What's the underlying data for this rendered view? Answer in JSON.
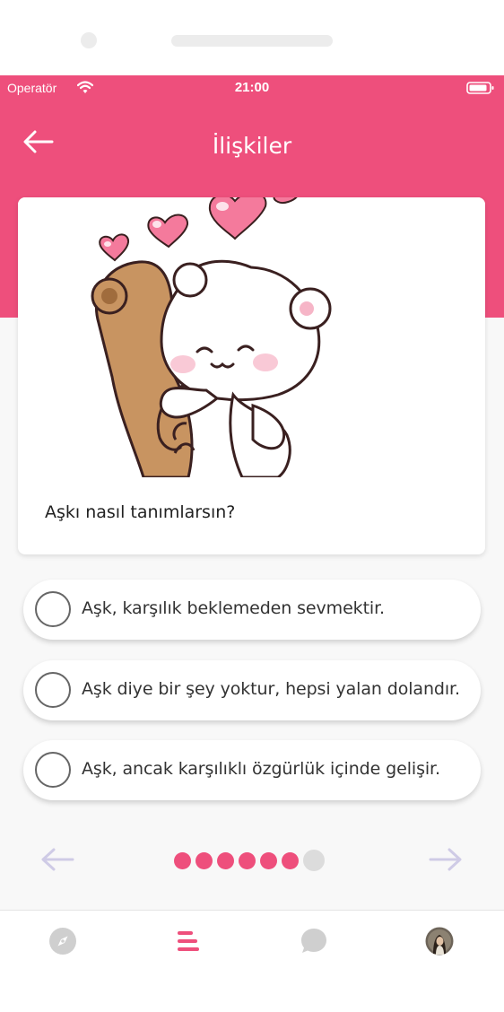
{
  "status_bar": {
    "carrier": "Operatör",
    "time": "21:00",
    "wifi_icon": "wifi-icon",
    "battery_icon": "battery-icon"
  },
  "header": {
    "title": "İlişkiler",
    "back_icon": "arrow-left-icon",
    "background_color": "#ee4f7c"
  },
  "card": {
    "image": "hugging-bears-with-hearts-illustration",
    "question": "Aşkı nasıl tanımlarsın?"
  },
  "options": [
    {
      "label": "Aşk, karşılık beklemeden sevmektir.",
      "selected": false
    },
    {
      "label": "Aşk diye bir şey yoktur, hepsi yalan dolandır.",
      "selected": false
    },
    {
      "label": "Aşk, ancak karşılıklı özgürlük içinde gelişir.",
      "selected": false
    }
  ],
  "pager": {
    "prev_icon": "arrow-left-icon",
    "next_icon": "arrow-right-icon",
    "total_pages": 7,
    "completed_pages": 6,
    "active_color": "#ee4f7c",
    "inactive_color": "#dcdcdc"
  },
  "tab_bar": {
    "tabs": [
      {
        "icon": "compass-icon",
        "active": false
      },
      {
        "icon": "list-icon",
        "active": true
      },
      {
        "icon": "chat-bubble-icon",
        "active": false
      },
      {
        "icon": "profile-avatar-icon",
        "active": false
      }
    ]
  }
}
